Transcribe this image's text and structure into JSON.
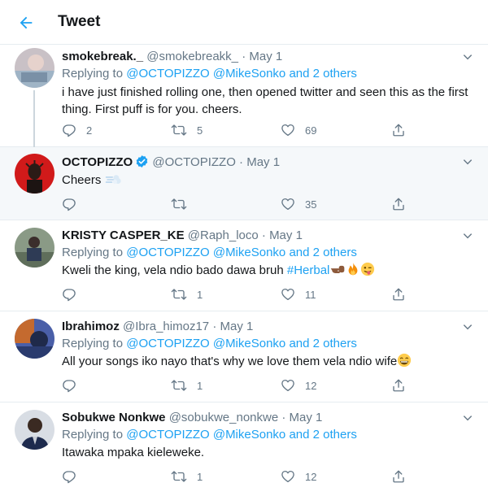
{
  "header": {
    "title": "Tweet"
  },
  "colors": {
    "accent": "#1da1f2",
    "muted": "#657786",
    "text": "#14171a",
    "border": "#e6ecf0"
  },
  "tweets": [
    {
      "name": "smokebreak._",
      "handle": "@smokebreakk_",
      "dot": "·",
      "date": "May 1",
      "replying_prefix": "Replying to",
      "replying_mentions": "@OCTOPIZZO @MikeSonko",
      "replying_and": "and",
      "replying_others": "2 others",
      "text": "i have just finished rolling one, then opened twitter and seen this as the first thing. First puff is for you. cheers.",
      "replies": "2",
      "retweets": "5",
      "likes": "69"
    },
    {
      "name": "OCTOPIZZO",
      "handle": "@OCTOPIZZO",
      "dot": "·",
      "date": "May 1",
      "verified": true,
      "text": "Cheers",
      "emoji": "dash-emoji",
      "replies": "",
      "retweets": "",
      "likes": "35"
    },
    {
      "name": "KRISTY CASPER_KE",
      "handle": "@Raph_loco",
      "dot": "·",
      "date": "May 1",
      "replying_prefix": "Replying to",
      "replying_mentions": "@OCTOPIZZO @MikeSonko",
      "replying_and": "and",
      "replying_others": "2 others",
      "text": "Kweli the king, vela ndio bado dawa bruh ",
      "hashtag": "#Herbal",
      "replies": "",
      "retweets": "1",
      "likes": "11"
    },
    {
      "name": "Ibrahimoz",
      "handle": "@Ibra_himoz17",
      "dot": "·",
      "date": "May 1",
      "replying_prefix": "Replying to",
      "replying_mentions": "@OCTOPIZZO @MikeSonko",
      "replying_and": "and",
      "replying_others": "2 others",
      "text": "All your songs iko nayo that's why we love them vela ndio wife",
      "replies": "",
      "retweets": "1",
      "likes": "12"
    },
    {
      "name": "Sobukwe Nonkwe",
      "handle": "@sobukwe_nonkwe",
      "dot": "·",
      "date": "May 1",
      "replying_prefix": "Replying to",
      "replying_mentions": "@OCTOPIZZO @MikeSonko",
      "replying_and": "and",
      "replying_others": "2 others",
      "text": "Itawaka mpaka kieleweke.",
      "replies": "",
      "retweets": "1",
      "likes": "12"
    }
  ]
}
